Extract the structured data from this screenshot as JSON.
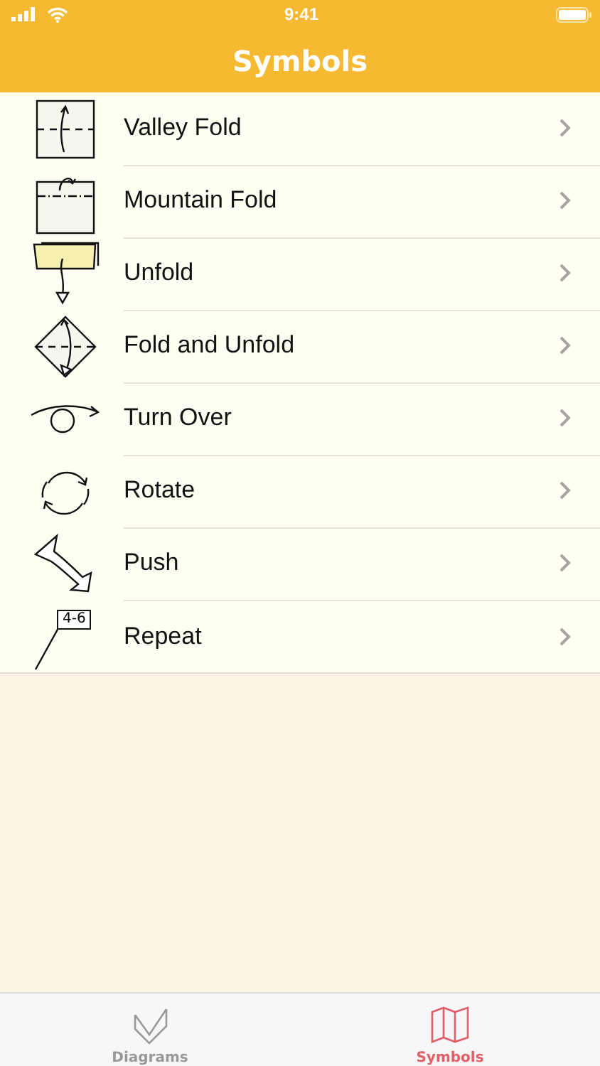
{
  "status_bar": {
    "time": "9:41"
  },
  "nav": {
    "title": "Symbols"
  },
  "symbols": [
    {
      "kind": "valley",
      "label": "Valley Fold"
    },
    {
      "kind": "mountain",
      "label": "Mountain Fold"
    },
    {
      "kind": "unfold",
      "label": "Unfold"
    },
    {
      "kind": "fold_unfold",
      "label": "Fold and Unfold"
    },
    {
      "kind": "turn_over",
      "label": "Turn Over"
    },
    {
      "kind": "rotate",
      "label": "Rotate"
    },
    {
      "kind": "push",
      "label": "Push"
    },
    {
      "kind": "repeat",
      "label": "Repeat",
      "tag": "4-6"
    }
  ],
  "tabs": [
    {
      "kind": "diagrams",
      "label": "Diagrams",
      "selected": false
    },
    {
      "kind": "symbols",
      "label": "Symbols",
      "selected": true
    }
  ]
}
